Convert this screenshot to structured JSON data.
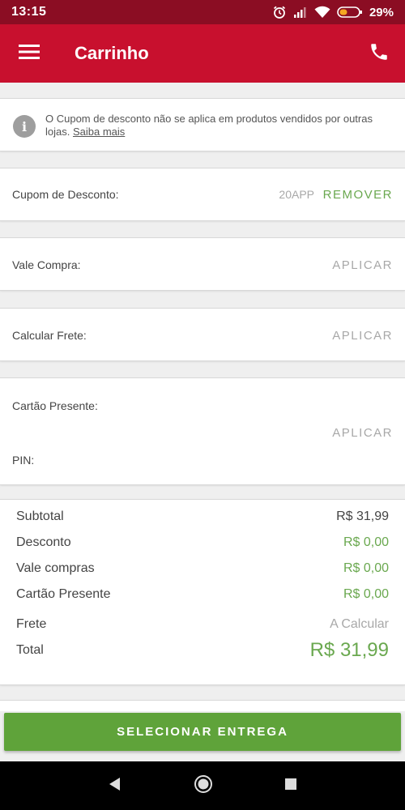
{
  "status": {
    "time": "13:15",
    "battery_pct": "29%",
    "icons": [
      "alarm-icon",
      "signal-icon",
      "wifi-icon",
      "battery-icon"
    ]
  },
  "app_bar": {
    "title": "Carrinho",
    "icons": [
      "menu-icon",
      "phone-icon"
    ]
  },
  "info": {
    "text": "O Cupom de desconto não se aplica em produtos vendidos por outras lojas.",
    "link": "Saiba mais"
  },
  "coupon": {
    "label": "Cupom de Desconto:",
    "code": "20APP",
    "action": "REMOVER"
  },
  "voucher": {
    "label": "Vale Compra:",
    "action": "APLICAR"
  },
  "shipping": {
    "label": "Calcular Frete:",
    "action": "APLICAR"
  },
  "gift_card": {
    "label": "Cartão Presente:",
    "pin_label": "PIN:",
    "action": "APLICAR"
  },
  "summary": {
    "rows": [
      {
        "label": "Subtotal",
        "value": "R$  31,99"
      },
      {
        "label": "Desconto",
        "value": "R$ 0,00"
      },
      {
        "label": "Vale compras",
        "value": "R$ 0,00"
      },
      {
        "label": "Cartão Presente",
        "value": "R$ 0,00"
      },
      {
        "label": "Frete",
        "value": "A Calcular"
      }
    ],
    "total_label": "Total",
    "total_value": "R$  31,99"
  },
  "cta": {
    "label": "SELECIONAR ENTREGA"
  },
  "colors": {
    "status_bar": "#8b0d23",
    "app_bar": "#c8102e",
    "accent_green": "#6aa84f",
    "cta_green": "#5fa33a"
  }
}
